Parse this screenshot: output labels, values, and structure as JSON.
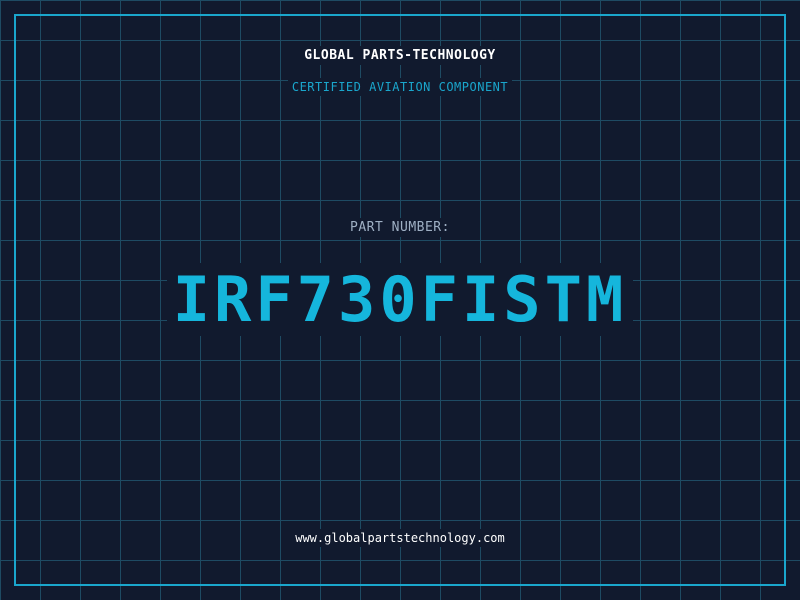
{
  "header": {
    "company": "GLOBAL PARTS-TECHNOLOGY",
    "subtitle": "CERTIFIED AVIATION COMPONENT"
  },
  "part": {
    "label": "PART NUMBER:",
    "number": "IRF730FISTM"
  },
  "footer": {
    "website": "www.globalpartstechnology.com"
  },
  "colors": {
    "background": "#111a2e",
    "grid": "#1e4b63",
    "accent": "#15b6dc",
    "text": "#ffffff",
    "muted": "#9fb0c4"
  }
}
